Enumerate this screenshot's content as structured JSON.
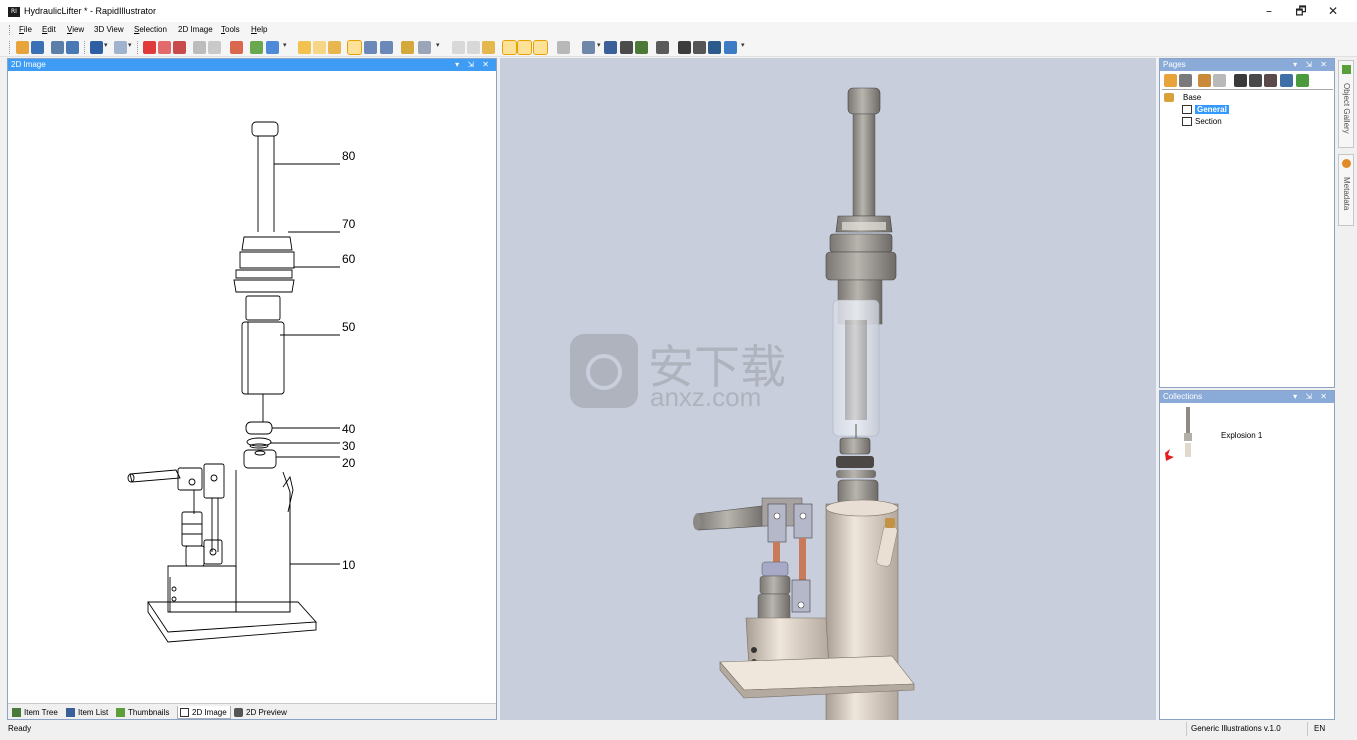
{
  "window": {
    "title": "HydraulicLifter * - RapidIllustrator",
    "icon_text": "RI",
    "controls": [
      "–",
      "🗗",
      "✕"
    ]
  },
  "menu": [
    {
      "label": "File",
      "u": "F",
      "rest": "ile"
    },
    {
      "label": "Edit",
      "u": "E",
      "rest": "dit"
    },
    {
      "label": "View",
      "u": "V",
      "rest": "iew"
    },
    {
      "label": "3D View",
      "u": "",
      "rest": "3D View"
    },
    {
      "label": "Selection",
      "u": "S",
      "rest": "election"
    },
    {
      "label": "2D Image",
      "u": "",
      "rest": "2D Image"
    },
    {
      "label": "Tools",
      "u": "T",
      "rest": "ools"
    },
    {
      "label": "Help",
      "u": "H",
      "rest": "elp"
    }
  ],
  "panel2d": {
    "title": "2D Image",
    "header_controls": "▾ ⇲ ✕",
    "callouts": [
      "80",
      "70",
      "60",
      "50",
      "40",
      "30",
      "20",
      "10"
    ],
    "bottom_tabs": [
      "Item Tree",
      "Item List",
      "Thumbnails",
      "2D Image",
      "2D Preview"
    ],
    "active_tab": "2D Image"
  },
  "view3d": {
    "watermark_cn": "安下载",
    "watermark_en": "anxz.com"
  },
  "pages_panel": {
    "title": "Pages",
    "header_controls": "▾ ⇲ ✕",
    "tree": {
      "root": "Base",
      "children": [
        "General",
        "Section"
      ],
      "selected": "General"
    }
  },
  "collections_panel": {
    "title": "Collections",
    "header_controls": "▾ ⇲ ✕",
    "items": [
      {
        "label": "Explosion 1"
      }
    ]
  },
  "side_tabs": [
    "Object Gallery",
    "Metadata"
  ],
  "status": {
    "text": "Ready",
    "library": "Generic Illustrations v.1.0",
    "lang": "EN"
  },
  "colors": {
    "active_header": "#3f9cf4",
    "inactive_header": "#8aaad8",
    "viewport_bg": "#c8cedc",
    "selection": "#3399ff"
  }
}
